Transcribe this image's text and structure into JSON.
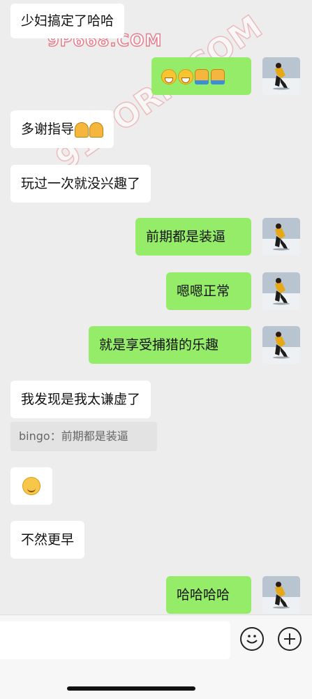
{
  "watermarks": {
    "top": "9P668.COM",
    "diagonal": "91PORN.COM"
  },
  "messages": [
    {
      "side": "left",
      "text": "少妇搞定了哈哈"
    },
    {
      "side": "right",
      "text": "",
      "emoji": [
        "grin-face",
        "grin-face",
        "thumbs-up",
        "thumbs-up"
      ]
    },
    {
      "side": "left",
      "text": "多谢指导",
      "emoji": [
        "praying-hands",
        "praying-hands"
      ]
    },
    {
      "side": "left",
      "text": "玩过一次就没兴趣了"
    },
    {
      "side": "right",
      "text": "前期都是装逼"
    },
    {
      "side": "right",
      "text": "嗯嗯正常"
    },
    {
      "side": "right",
      "text": "就是享受捕猎的乐趣"
    },
    {
      "side": "left",
      "text": "我发现是我太谦虚了"
    },
    {
      "side": "quote",
      "text": "bingo：前期都是装逼"
    },
    {
      "side": "left",
      "text": "",
      "emoji": [
        "smiling-face"
      ]
    },
    {
      "side": "left",
      "text": "不然更早"
    },
    {
      "side": "right",
      "text": "哈哈哈哈"
    }
  ],
  "input_bar": {
    "emoji_icon": "smiley-icon",
    "add_icon": "plus-icon"
  },
  "colors": {
    "background": "#ededed",
    "sent_bubble": "#95ec69",
    "received_bubble": "#ffffff"
  }
}
